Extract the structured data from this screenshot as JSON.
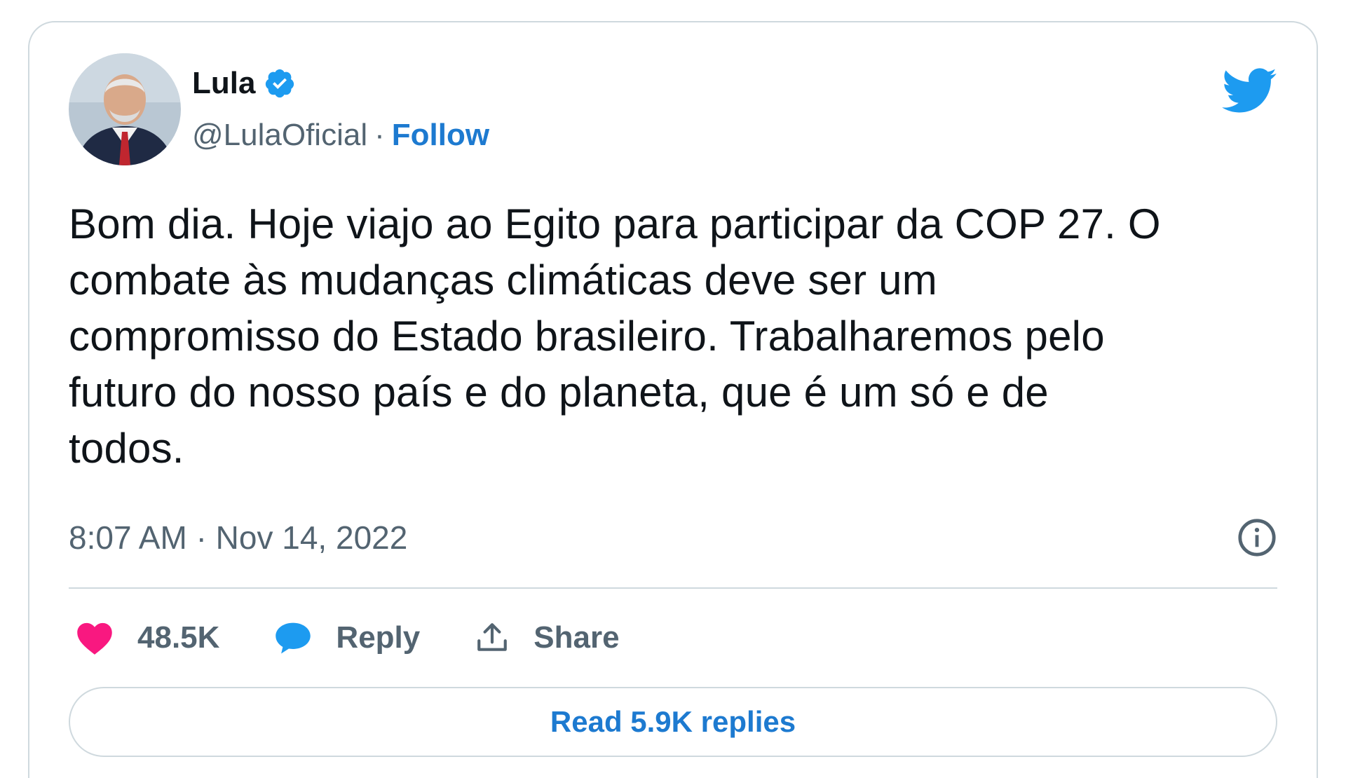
{
  "author": {
    "display_name": "Lula",
    "handle": "@LulaOficial",
    "separator": "·",
    "follow_label": "Follow",
    "verified": true
  },
  "tweet": {
    "text": "Bom dia. Hoje viajo ao Egito para participar da COP 27. O\ncombate às mudanças climáticas deve ser um\ncompromisso do Estado brasileiro. Trabalharemos pelo\nfuturo do nosso país e do planeta, que é um só e de\ntodos.",
    "time": "8:07 AM",
    "meta_separator": "·",
    "date": "Nov 14, 2022"
  },
  "actions": {
    "like_count": "48.5K",
    "reply_label": "Reply",
    "share_label": "Share"
  },
  "replies_button": {
    "label": "Read 5.9K replies"
  },
  "icons": {
    "brand": "twitter-bird-icon",
    "verified": "verified-badge-icon",
    "info": "info-icon",
    "like": "heart-icon",
    "reply": "speech-bubble-icon",
    "share": "share-upload-icon"
  },
  "colors": {
    "link_blue": "#1d7ad0",
    "twitter_blue": "#1d9bf0",
    "like_pink": "#f91880",
    "muted_text": "#536471",
    "border": "#cfd9de"
  }
}
